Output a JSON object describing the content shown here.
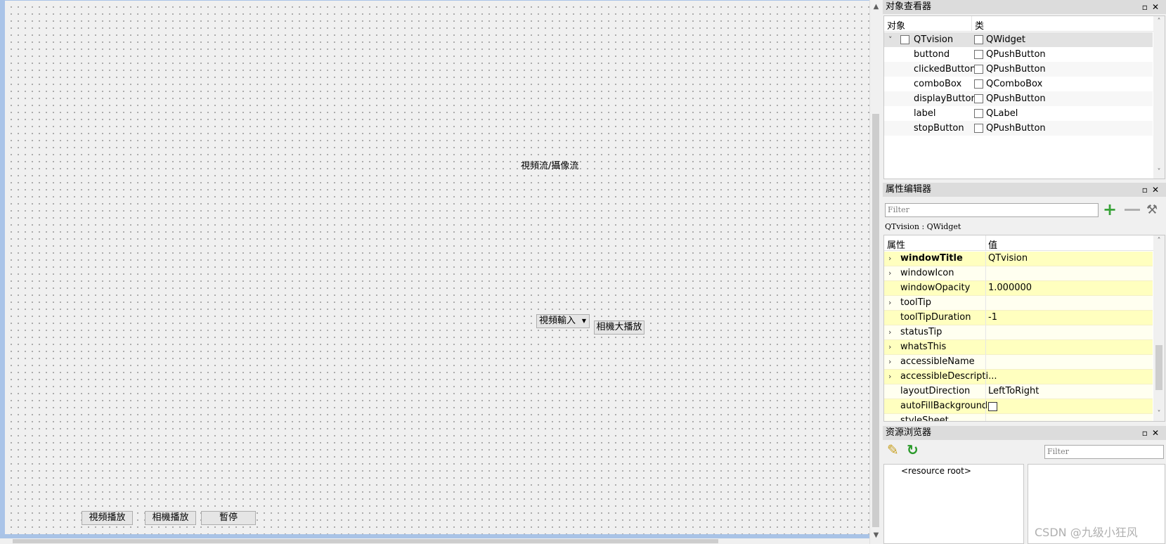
{
  "form": {
    "video_label": "視頻流/攝像流",
    "combo_value": "視頻輸入",
    "camera_zoom_button": "相機大播放",
    "video_play_button": "視頻播放",
    "camera_play_button": "相機播放",
    "pause_button": "暫停"
  },
  "object_inspector": {
    "title": "对象查看器",
    "col_object": "对象",
    "col_class": "类",
    "rows": [
      {
        "name": "QTvision",
        "class": "QWidget",
        "icon": "widget-icon"
      },
      {
        "name": "buttond",
        "class": "QPushButton",
        "icon": "pushbutton-icon"
      },
      {
        "name": "clickedButton",
        "class": "QPushButton",
        "icon": "pushbutton-icon"
      },
      {
        "name": "comboBox",
        "class": "QComboBox",
        "icon": "combobox-icon"
      },
      {
        "name": "displayButton",
        "class": "QPushButton",
        "icon": "pushbutton-icon"
      },
      {
        "name": "label",
        "class": "QLabel",
        "icon": "label-icon"
      },
      {
        "name": "stopButton",
        "class": "QPushButton",
        "icon": "pushbutton-icon"
      }
    ]
  },
  "property_editor": {
    "title": "属性编辑器",
    "filter_placeholder": "Filter",
    "context": "QTvision : QWidget",
    "col_property": "属性",
    "col_value": "值",
    "rows": [
      {
        "name": "windowTitle",
        "value": "QTvision"
      },
      {
        "name": "windowIcon",
        "value": ""
      },
      {
        "name": "windowOpacity",
        "value": "1.000000"
      },
      {
        "name": "toolTip",
        "value": ""
      },
      {
        "name": "toolTipDuration",
        "value": "-1"
      },
      {
        "name": "statusTip",
        "value": ""
      },
      {
        "name": "whatsThis",
        "value": ""
      },
      {
        "name": "accessibleName",
        "value": ""
      },
      {
        "name": "accessibleDescripti...",
        "value": ""
      },
      {
        "name": "layoutDirection",
        "value": "LeftToRight"
      },
      {
        "name": "autoFillBackground",
        "value": ""
      },
      {
        "name": "styleSheet",
        "value": ""
      }
    ]
  },
  "resource_browser": {
    "title": "资源浏览器",
    "filter_placeholder": "Filter",
    "root": "<resource root>"
  },
  "watermark": "CSDN @九级小狂风"
}
